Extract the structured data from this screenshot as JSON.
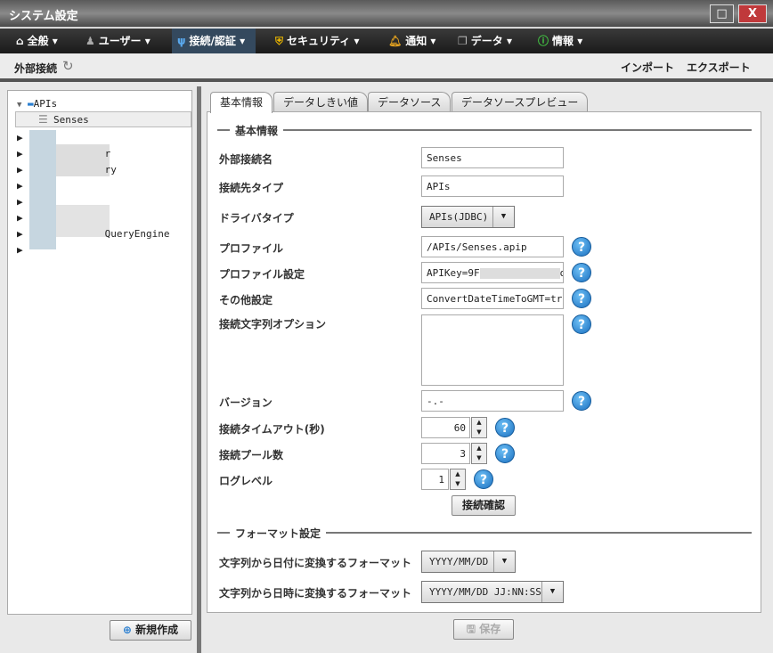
{
  "window": {
    "title": "システム設定",
    "maximize": "□",
    "close": "X"
  },
  "menu": [
    {
      "label": "全般",
      "icon": "home-icon"
    },
    {
      "label": "ユーザー",
      "icon": "user-icon"
    },
    {
      "label": "接続/認証",
      "icon": "plug-icon"
    },
    {
      "label": "セキュリティ",
      "icon": "shield-icon"
    },
    {
      "label": "通知",
      "icon": "bell-icon"
    },
    {
      "label": "データ",
      "icon": "data-icon"
    },
    {
      "label": "情報",
      "icon": "info-icon"
    }
  ],
  "subheader": {
    "title": "外部接続",
    "import": "インポート",
    "export": "エクスポート"
  },
  "tree": {
    "root": "APIs",
    "selected": "Senses",
    "rows": [
      "",
      "r",
      "ry",
      "",
      "",
      "",
      "QueryEngine",
      ""
    ]
  },
  "new_button": "新規作成",
  "tabs": [
    "基本情報",
    "データしきい値",
    "データソース",
    "データソースプレビュー"
  ],
  "basic": {
    "section": "基本情報",
    "fields": [
      {
        "label": "外部接続名",
        "value": "Senses"
      },
      {
        "label": "接続先タイプ",
        "value": "APIs"
      },
      {
        "label": "ドライバタイプ",
        "value": "APIs(JDBC)"
      },
      {
        "label": "プロファイル",
        "value": "/APIs/Senses.apip"
      },
      {
        "label": "プロファイル設定",
        "value": "APIKey=9F",
        "value_end": "oE"
      },
      {
        "label": "その他設定",
        "value": "ConvertDateTimeToGMT=true;"
      },
      {
        "label": "接続文字列オプション",
        "value": ""
      },
      {
        "label": "バージョン",
        "value": "-.-"
      },
      {
        "label": "接続タイムアウト(秒)",
        "value": "60"
      },
      {
        "label": "接続プール数",
        "value": "3"
      },
      {
        "label": "ログレベル",
        "value": "1"
      }
    ],
    "test_button": "接続確認"
  },
  "format": {
    "section": "フォーマット設定",
    "date_label": "文字列から日付に変換するフォーマット",
    "date_value": "YYYY/MM/DD",
    "datetime_label": "文字列から日時に変換するフォーマット",
    "datetime_value": "YYYY/MM/DD JJ:NN:SS"
  },
  "save_button": "保存"
}
